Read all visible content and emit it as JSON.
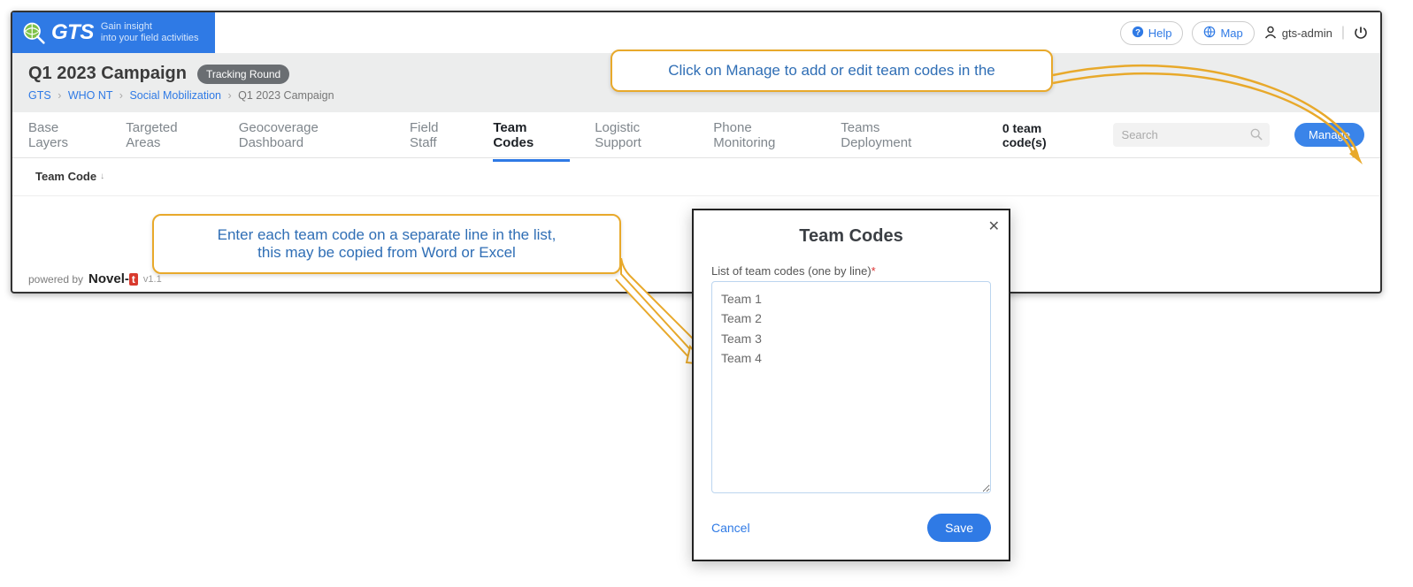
{
  "brand": {
    "name": "GTS",
    "tagline_line1": "Gain insight",
    "tagline_line2": "into your field activities"
  },
  "topbar": {
    "help_label": "Help",
    "map_label": "Map",
    "user_label": "gts-admin"
  },
  "page": {
    "title": "Q1 2023 Campaign",
    "badge": "Tracking Round"
  },
  "breadcrumb": {
    "items": [
      {
        "label": "GTS",
        "link": true
      },
      {
        "label": "WHO NT",
        "link": true
      },
      {
        "label": "Social Mobilization",
        "link": true
      },
      {
        "label": "Q1 2023 Campaign",
        "link": false
      }
    ],
    "separator": "›"
  },
  "tabs": {
    "items": [
      {
        "label": "Base Layers",
        "active": false
      },
      {
        "label": "Targeted Areas",
        "active": false
      },
      {
        "label": "Geocoverage Dashboard",
        "active": false
      },
      {
        "label": "Field Staff",
        "active": false
      },
      {
        "label": "Team Codes",
        "active": true
      },
      {
        "label": "Logistic Support",
        "active": false
      },
      {
        "label": "Phone Monitoring",
        "active": false
      },
      {
        "label": "Teams Deployment",
        "active": false
      }
    ],
    "count_label": "0 team code(s)",
    "search_placeholder": "Search",
    "manage_label": "Manage"
  },
  "table": {
    "col1": "Team Code"
  },
  "modal": {
    "title": "Team Codes",
    "label": "List of team codes (one by line)",
    "required_marker": "*",
    "value": "Team 1\nTeam 2\nTeam 3\nTeam 4",
    "cancel_label": "Cancel",
    "save_label": "Save"
  },
  "callouts": {
    "manage_hint": "Click on Manage to add or edit team codes in the",
    "textarea_hint_line1": "Enter each team code on a separate line in the list,",
    "textarea_hint_line2": "this may be copied from Word or Excel"
  },
  "footer": {
    "powered_by": "powered by",
    "company": "Novel-",
    "company_suffix": "t",
    "version": "v1.1"
  }
}
